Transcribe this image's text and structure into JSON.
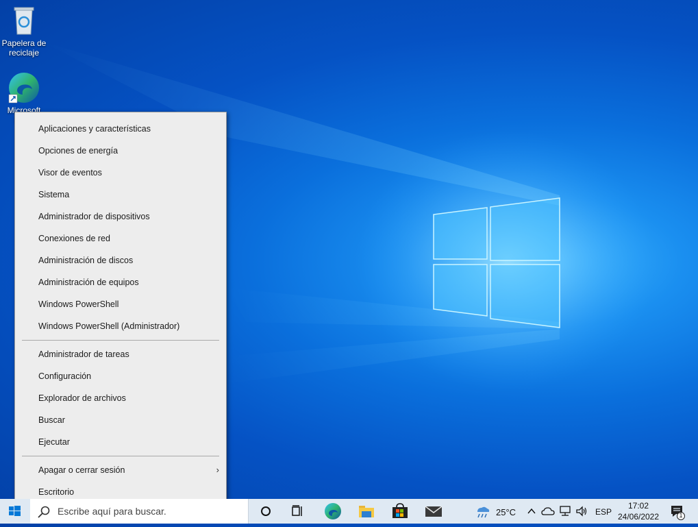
{
  "desktop": {
    "icons": [
      {
        "label": "Papelera de reciclaje",
        "icon": "recycle-bin-icon"
      },
      {
        "label": "Microsoft Edge",
        "icon": "edge-icon"
      }
    ]
  },
  "menu": {
    "group1": [
      "Aplicaciones y características",
      "Opciones de energía",
      "Visor de eventos",
      "Sistema",
      "Administrador de dispositivos",
      "Conexiones de red",
      "Administración de discos",
      "Administración de equipos",
      "Windows PowerShell",
      "Windows PowerShell (Administrador)"
    ],
    "group2": [
      "Administrador de tareas",
      "Configuración",
      "Explorador de archivos",
      "Buscar",
      "Ejecutar"
    ],
    "group3": [
      "Apagar o cerrar sesión",
      "Escritorio"
    ],
    "submenu_chevron": "›"
  },
  "taskbar": {
    "search_placeholder": "Escribe aquí para buscar.",
    "apps": [
      "cortana-icon",
      "task-view-icon",
      "edge-icon",
      "file-explorer-icon",
      "store-icon",
      "mail-icon"
    ],
    "weather_temp": "25°C",
    "language": "ESP",
    "time": "17:02",
    "date": "24/06/2022",
    "notification_count": "1"
  },
  "colors": {
    "accent": "#0078d7",
    "menu_bg": "#ededed",
    "taskbar_bg": "#dfe9f3"
  }
}
